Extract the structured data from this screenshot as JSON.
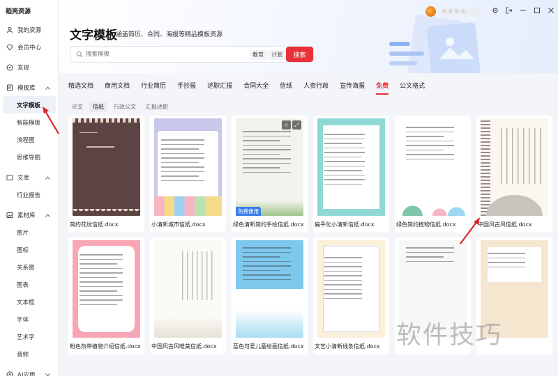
{
  "app": {
    "brand": "稻壳资源"
  },
  "sidebar": {
    "items": [
      {
        "label": "我的资源",
        "icon": "user-icon",
        "type": "top"
      },
      {
        "label": "会员中心",
        "icon": "diamond-icon",
        "type": "top"
      },
      {
        "label": "发现",
        "icon": "compass-icon",
        "type": "top"
      },
      {
        "label": "模板库",
        "icon": "template-icon",
        "type": "group"
      },
      {
        "label": "文字模板",
        "type": "active"
      },
      {
        "label": "智能模板",
        "type": "sub"
      },
      {
        "label": "流程图",
        "type": "sub"
      },
      {
        "label": "思维导图",
        "type": "sub"
      },
      {
        "label": "文库",
        "icon": "book-icon",
        "type": "group"
      },
      {
        "label": "行业报告",
        "type": "sub"
      },
      {
        "label": "素材库",
        "icon": "material-icon",
        "type": "group"
      },
      {
        "label": "图片",
        "type": "sub"
      },
      {
        "label": "图标",
        "type": "sub"
      },
      {
        "label": "关系图",
        "type": "sub"
      },
      {
        "label": "图表",
        "type": "sub"
      },
      {
        "label": "文本框",
        "type": "sub"
      },
      {
        "label": "字体",
        "type": "sub"
      },
      {
        "label": "艺术字",
        "type": "sub"
      },
      {
        "label": "音频",
        "type": "sub"
      },
      {
        "label": "AI应用",
        "icon": "ai-icon",
        "type": "group"
      }
    ]
  },
  "header": {
    "title": "文字模板",
    "subtitle": "涵盖简历、合同、海报等精品模板资源",
    "search_placeholder": "搜索模板",
    "chips": [
      "教育",
      "计划"
    ],
    "search_button": "搜索"
  },
  "tabs": [
    "精选文档",
    "商用文档",
    "行业简历",
    "手抄报",
    "述职汇报",
    "合同大全",
    "信纸",
    "人资行政",
    "宣传海报",
    "免费",
    "公文格式"
  ],
  "active_tab": "免费",
  "subtabs": [
    "论文",
    "信纸",
    "行政公文",
    "汇报述职"
  ],
  "active_subtab": "信纸",
  "cards": [
    {
      "caption": "简约花纹信纸.docx",
      "badge": "",
      "style": "brown"
    },
    {
      "caption": "小清新城市信纸.docx",
      "badge": "",
      "style": "city"
    },
    {
      "caption": "绿色清新简约手绘信纸.docx",
      "badge": "免费使用",
      "style": "green"
    },
    {
      "caption": "扁平化小清新信纸.docx",
      "badge": "",
      "style": "teal"
    },
    {
      "caption": "绿色简约植物信纸.docx",
      "badge": "",
      "style": "plant"
    },
    {
      "caption": "中国风古风信纸.docx",
      "badge": "",
      "style": "chinese"
    },
    {
      "caption": "粉色热带植物介绍信纸.docx",
      "badge": "",
      "style": "pink"
    },
    {
      "caption": "中国风古风唯美信纸.docx",
      "badge": "",
      "style": "plain"
    },
    {
      "caption": "蓝色可爱儿童绘画信纸.docx",
      "badge": "",
      "style": "blue"
    },
    {
      "caption": "文艺小清新线条信纸.docx",
      "badge": "",
      "style": "lines"
    },
    {
      "caption": "",
      "badge": "",
      "style": "dots"
    },
    {
      "caption": "",
      "badge": "",
      "style": "flower"
    }
  ],
  "card_brown_text": "",
  "watermark": "软件技巧",
  "colors": {
    "accent": "#e8313b",
    "free_badge": "#3c7de8",
    "arrow": "#d8232a"
  }
}
